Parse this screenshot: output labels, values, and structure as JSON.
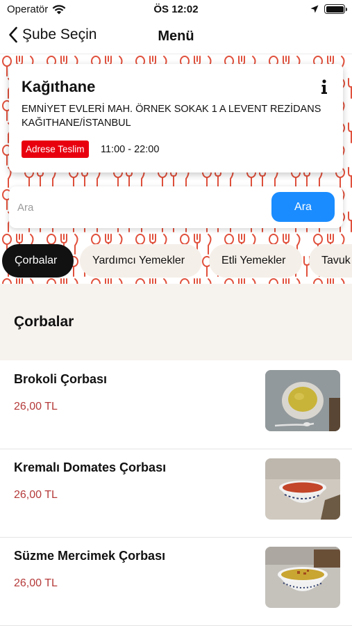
{
  "status_bar": {
    "carrier": "Operatör",
    "time": "ÖS 12:02"
  },
  "nav": {
    "back_label": "Şube Seçin",
    "title": "Menü"
  },
  "branch": {
    "name": "Kağıthane",
    "address": "EMNİYET EVLERİ MAH. ÖRNEK SOKAK 1 A LEVENT REZİDANS KAĞITHANE/İSTANBUL",
    "delivery_badge": "Adrese Teslim",
    "hours": "11:00 - 22:00"
  },
  "search": {
    "placeholder": "Ara",
    "button_label": "Ara"
  },
  "categories": [
    {
      "label": "Çorbalar",
      "active": true
    },
    {
      "label": "Yardımcı Yemekler",
      "active": false
    },
    {
      "label": "Etli Yemekler",
      "active": false
    },
    {
      "label": "Tavuk",
      "active": false
    }
  ],
  "section": {
    "title": "Çorbalar"
  },
  "products": [
    {
      "name": "Brokoli Çorbası",
      "price": "26,00 TL"
    },
    {
      "name": "Kremalı Domates Çorbası",
      "price": "26,00 TL"
    },
    {
      "name": "Süzme Mercimek Çorbası",
      "price": "26,00 TL"
    }
  ],
  "colors": {
    "accent_blue": "#1a8cff",
    "badge_red": "#e8000f",
    "price_red": "#b53a3a",
    "pattern_red": "#e0503c",
    "tab_bg": "#f5efe9",
    "section_bg": "#f6f2ee"
  },
  "icons": {
    "back": "chevron-left-icon",
    "info": "info-icon",
    "wifi": "wifi-icon",
    "location": "location-arrow-icon",
    "battery": "battery-icon"
  }
}
